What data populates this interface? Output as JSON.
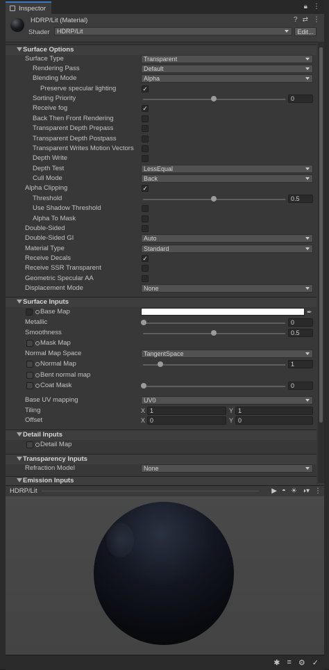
{
  "tab": {
    "label": "Inspector"
  },
  "material": {
    "name": "HDRP/Lit (Material)",
    "shader_label": "Shader",
    "shader_value": "HDRP/Lit",
    "edit_label": "Edit..."
  },
  "surface_options": {
    "title": "Surface Options",
    "surface_type": {
      "label": "Surface Type",
      "value": "Transparent"
    },
    "rendering_pass": {
      "label": "Rendering Pass",
      "value": "Default"
    },
    "blending_mode": {
      "label": "Blending Mode",
      "value": "Alpha"
    },
    "preserve_specular": {
      "label": "Preserve specular lighting",
      "checked": true
    },
    "sorting_priority": {
      "label": "Sorting Priority",
      "value": "0",
      "slider_fraction": 0.5
    },
    "receive_fog": {
      "label": "Receive fog",
      "checked": true
    },
    "back_then_front": {
      "label": "Back Then Front Rendering",
      "checked": false
    },
    "depth_prepass": {
      "label": "Transparent Depth Prepass",
      "checked": false
    },
    "depth_postpass": {
      "label": "Transparent Depth Postpass",
      "checked": false
    },
    "writes_motion": {
      "label": "Transparent Writes Motion Vectors",
      "checked": false
    },
    "depth_write": {
      "label": "Depth Write",
      "checked": false
    },
    "depth_test": {
      "label": "Depth Test",
      "value": "LessEqual"
    },
    "cull_mode": {
      "label": "Cull Mode",
      "value": "Back"
    },
    "alpha_clipping": {
      "label": "Alpha Clipping",
      "checked": true
    },
    "threshold": {
      "label": "Threshold",
      "value": "0.5",
      "slider_fraction": 0.5
    },
    "use_shadow_threshold": {
      "label": "Use Shadow Threshold",
      "checked": false
    },
    "alpha_to_mask": {
      "label": "Alpha To Mask",
      "checked": false
    },
    "double_sided": {
      "label": "Double-Sided",
      "checked": false
    },
    "double_sided_gi": {
      "label": "Double-Sided GI",
      "value": "Auto"
    },
    "material_type": {
      "label": "Material Type",
      "value": "Standard"
    },
    "receive_decals": {
      "label": "Receive Decals",
      "checked": true
    },
    "receive_ssr": {
      "label": "Receive SSR Transparent",
      "checked": false
    },
    "specular_aa": {
      "label": "Geometric Specular AA",
      "checked": false
    },
    "displacement_mode": {
      "label": "Displacement Mode",
      "value": "None"
    }
  },
  "surface_inputs": {
    "title": "Surface Inputs",
    "base_map": {
      "label": "Base Map",
      "color": "#ffffff"
    },
    "metallic": {
      "label": "Metallic",
      "value": "0",
      "slider_fraction": 0.0
    },
    "smoothness": {
      "label": "Smoothness",
      "value": "0.5",
      "slider_fraction": 0.5
    },
    "mask_map": {
      "label": "Mask Map"
    },
    "normal_map_space": {
      "label": "Normal Map Space",
      "value": "TangentSpace"
    },
    "normal_map": {
      "label": "Normal Map",
      "value": "1",
      "slider_fraction": 0.125
    },
    "bent_normal_map": {
      "label": "Bent normal map"
    },
    "coat_mask": {
      "label": "Coat Mask",
      "value": "0",
      "slider_fraction": 0.0
    },
    "base_uv_mapping": {
      "label": "Base UV mapping",
      "value": "UV0"
    },
    "tiling": {
      "label": "Tiling",
      "x_label": "X",
      "x": "1",
      "y_label": "Y",
      "y": "1"
    },
    "offset": {
      "label": "Offset",
      "x_label": "X",
      "x": "0",
      "y_label": "Y",
      "y": "0"
    }
  },
  "detail_inputs": {
    "title": "Detail Inputs",
    "detail_map": {
      "label": "Detail Map"
    }
  },
  "transparency_inputs": {
    "title": "Transparency Inputs",
    "refraction_model": {
      "label": "Refraction Model",
      "value": "None"
    }
  },
  "emission_inputs": {
    "title": "Emission Inputs"
  },
  "preview": {
    "title": "HDRP/Lit"
  }
}
